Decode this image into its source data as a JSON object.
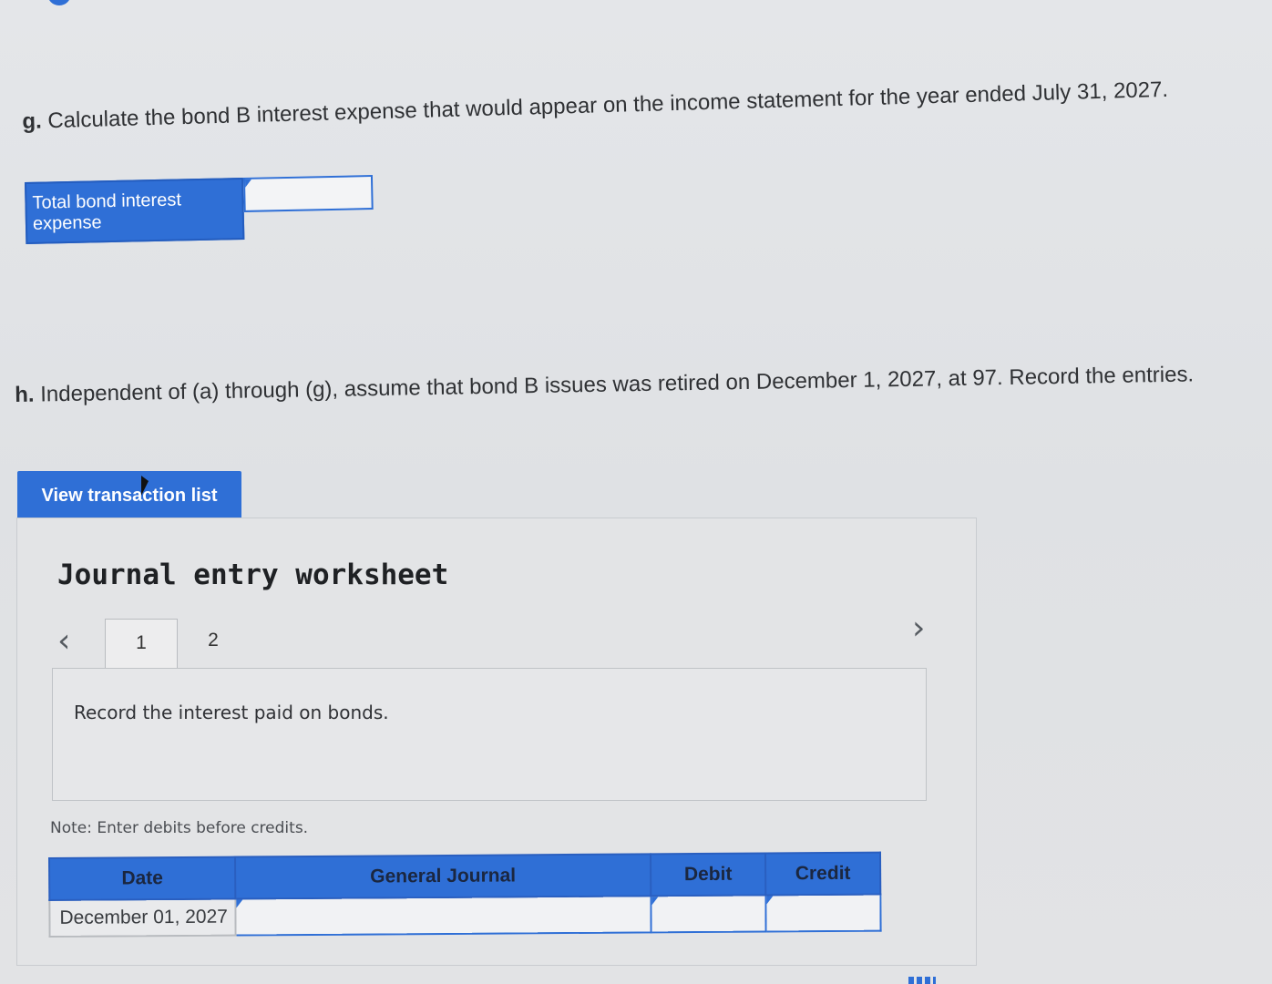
{
  "question_g": {
    "letter": "g.",
    "text": "Calculate the bond B interest expense that would appear on the income statement for the year ended July 31, 2027."
  },
  "answer_g": {
    "label": "Total bond interest expense",
    "value": ""
  },
  "question_h": {
    "letter": "h.",
    "text": "Independent of (a) through (g), assume that bond B issues was retired on December 1, 2027, at 97. Record the entries."
  },
  "view_button_label": "View transaction list",
  "worksheet": {
    "title": "Journal entry worksheet",
    "prev_icon": "chevron-left-icon",
    "next_icon": "chevron-right-icon",
    "tabs": [
      {
        "label": "1",
        "active": true
      },
      {
        "label": "2",
        "active": false
      }
    ],
    "description": "Record the interest paid on bonds.",
    "note": "Note: Enter debits before credits.",
    "table": {
      "headers": [
        "Date",
        "General Journal",
        "Debit",
        "Credit"
      ],
      "rows": [
        {
          "date": "December 01, 2027",
          "account": "",
          "debit": "",
          "credit": ""
        }
      ]
    }
  },
  "colors": {
    "accent": "#2f6fd6",
    "background": "#e2e3e5"
  }
}
